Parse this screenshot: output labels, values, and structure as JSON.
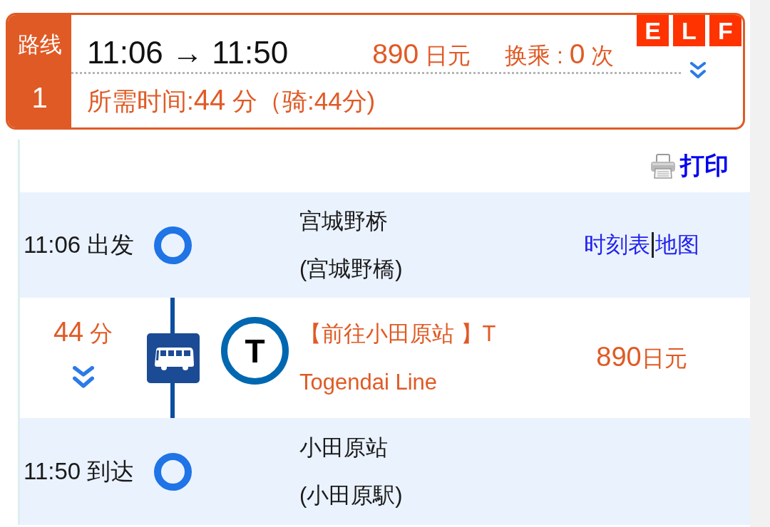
{
  "route_card": {
    "label": "路线",
    "number": "1",
    "times": "11:06 → 11:50",
    "fare": {
      "amount": "890",
      "unit": "日元"
    },
    "transfers": {
      "label": "换乘 :",
      "count": "0",
      "unit": "次"
    },
    "duration": {
      "label": "所需时间:",
      "amount": "44",
      "unit": "分",
      "detail": "（骑:44分)"
    },
    "badges": [
      "E",
      "L",
      "F"
    ]
  },
  "print_link": "打印",
  "steps": [
    {
      "kind": "stop",
      "time": "11:06 出发",
      "name": "宫城野桥",
      "name_local": "(宫城野橋)",
      "links": [
        "时刻表",
        "地图"
      ]
    },
    {
      "kind": "ride",
      "duration": {
        "amount": "44",
        "unit": "分"
      },
      "line_symbol": "T",
      "direction": "【前往小田原站 】T",
      "line": "Togendai Line",
      "fare": {
        "amount": "890",
        "unit": "日元"
      }
    },
    {
      "kind": "stop",
      "time": "11:50 到达",
      "name": "小田原站",
      "name_local": "(小田原駅)"
    }
  ]
}
